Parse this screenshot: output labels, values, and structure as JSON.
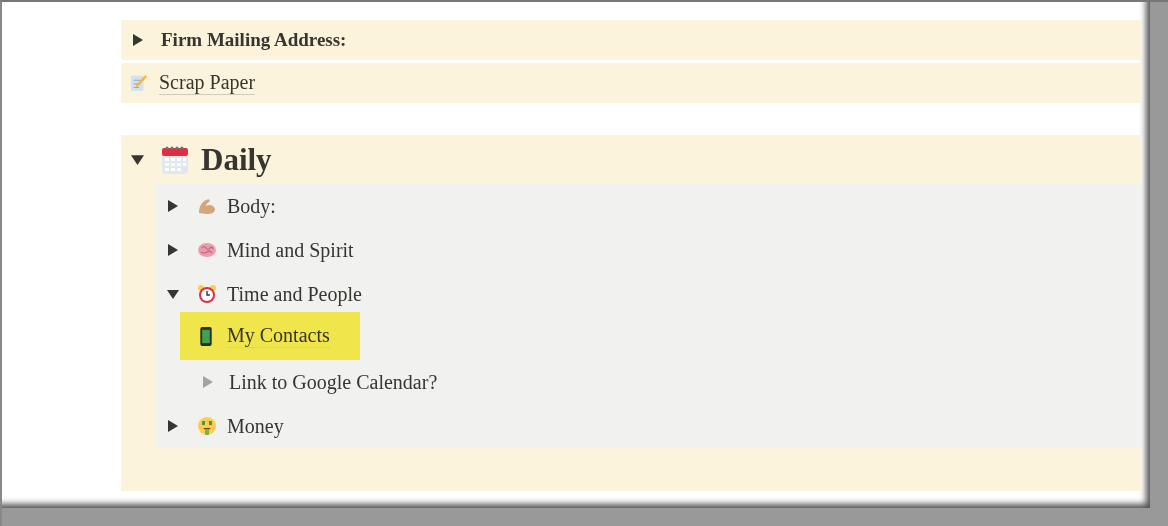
{
  "blocks": [
    {
      "kind": "toggle",
      "label": "Firm Mailing Address:",
      "expanded": false
    },
    {
      "kind": "page",
      "label": "Scrap Paper"
    }
  ],
  "section": {
    "kind": "heading",
    "label": "Daily",
    "expanded": true,
    "children": [
      {
        "kind": "toggle",
        "label": "Body:",
        "expanded": false
      },
      {
        "kind": "toggle",
        "label": "Mind and Spirit",
        "expanded": false
      },
      {
        "kind": "toggle",
        "label": "Time and People",
        "expanded": true,
        "children": [
          {
            "kind": "page",
            "label": "My Contacts",
            "highlighted": true
          },
          {
            "kind": "toggle",
            "label": "Link to Google Calendar?",
            "expanded": false,
            "empty": true,
            "highlighted": false
          }
        ]
      },
      {
        "kind": "toggle",
        "label": "Money",
        "expanded": false
      }
    ]
  }
}
